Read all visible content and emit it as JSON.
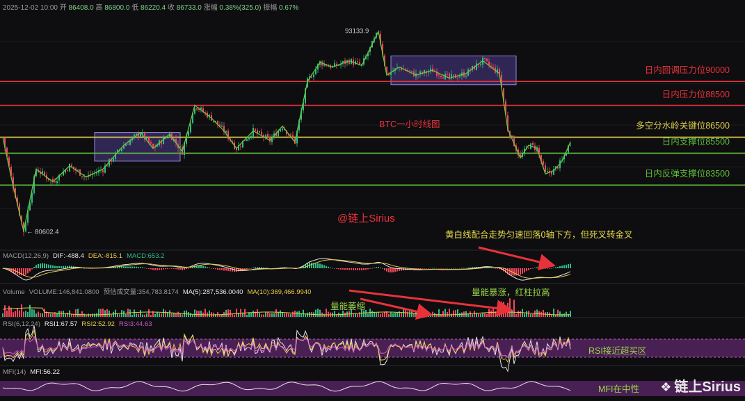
{
  "header": {
    "datetime": "2025-12-02 10:00",
    "open_label": "开",
    "open": "86408.0",
    "high_label": "高",
    "high": "86800.0",
    "low_label": "低",
    "low": "86220.4",
    "close_label": "收",
    "close": "86733.0",
    "change_label": "涨幅",
    "change": "0.38%(325.0)",
    "amp_label": "振幅",
    "amp": "0.67%"
  },
  "macd": {
    "title": "MACD(12,26,9)",
    "dif": "DIF:-488.4",
    "dea": "DEA:-815.1",
    "macd": "MACD:653.2"
  },
  "volume": {
    "title": "Volume",
    "vol": "VOLUME:146,841.0800",
    "est": "预估成交量:354,783.8174",
    "ma5": "MA(5):287,536.0040",
    "ma10": "MA(10):369,466.9940"
  },
  "rsi": {
    "title": "RSI(6,12,24)",
    "r1": "RSI1:67.57",
    "r2": "RSI2:52.92",
    "r3": "RSI3:44.63"
  },
  "mfi": {
    "title": "MFI(14)",
    "v": "MFI:56.22"
  },
  "levels": [
    {
      "label": "日内回调压力位90000",
      "price": 90000,
      "color": "#e8323a"
    },
    {
      "label": "日内压力位88500",
      "price": 88500,
      "color": "#e8323a"
    },
    {
      "label": "多空分水岭关键位86500",
      "price": 86500,
      "color": "#d9c84a"
    },
    {
      "label": "日内支撑位85500",
      "price": 85500,
      "color": "#5fbf3a"
    },
    {
      "label": "日内反弹支撑位83500",
      "price": 83500,
      "color": "#5fbf3a"
    }
  ],
  "annotations": {
    "chart_title": "BTC一小时线图",
    "author": "@链上Sirius",
    "macd_note": "黄白线配合走势匀速回落0轴下方，但死叉转金叉",
    "vol_spike": "量能暴涨，红柱拉高",
    "vol_shrink": "量能萎缩",
    "rsi_note": "RSI接近超买区",
    "mfi_note": "MFI在中性",
    "watermark": "链上Sirius"
  },
  "colors": {
    "up": "#2ebd85",
    "down": "#f6465d",
    "box": "#6a4fc4",
    "macd_dif": "#e6e6e6",
    "macd_dea": "#e6c84a",
    "rsi_band": "#7a2f8a"
  },
  "chart_data": {
    "type": "candlestick",
    "title": "BTC一小时线图",
    "ylim": [
      79500,
      94500
    ],
    "high_marker": {
      "label": "93133.9",
      "value": 93133.9
    },
    "low_marker": {
      "label": "80602.4",
      "value": 80602.4
    },
    "path": [
      [
        0,
        86500
      ],
      [
        4,
        84000
      ],
      [
        10,
        80602.4
      ],
      [
        16,
        84500
      ],
      [
        24,
        83700
      ],
      [
        32,
        84700
      ],
      [
        40,
        84000
      ],
      [
        48,
        84500
      ],
      [
        58,
        86000
      ],
      [
        66,
        86800
      ],
      [
        72,
        85800
      ],
      [
        80,
        86700
      ],
      [
        86,
        85600
      ],
      [
        92,
        88500
      ],
      [
        100,
        87700
      ],
      [
        106,
        86900
      ],
      [
        112,
        85800
      ],
      [
        120,
        86900
      ],
      [
        128,
        86300
      ],
      [
        134,
        87200
      ],
      [
        140,
        86200
      ],
      [
        146,
        90000
      ],
      [
        152,
        91200
      ],
      [
        158,
        90900
      ],
      [
        166,
        91300
      ],
      [
        172,
        91000
      ],
      [
        180,
        93133.9
      ],
      [
        184,
        90400
      ],
      [
        190,
        90900
      ],
      [
        198,
        90400
      ],
      [
        206,
        90700
      ],
      [
        214,
        90200
      ],
      [
        222,
        90500
      ],
      [
        230,
        91300
      ],
      [
        238,
        90500
      ],
      [
        242,
        87000
      ],
      [
        248,
        85200
      ],
      [
        252,
        86000
      ],
      [
        256,
        85800
      ],
      [
        260,
        84200
      ],
      [
        264,
        84400
      ],
      [
        268,
        85000
      ],
      [
        272,
        86200
      ]
    ],
    "boxes": [
      {
        "from": 44,
        "to": 85,
        "high": 86800,
        "low": 85000
      },
      {
        "from": 186,
        "to": 246,
        "high": 91600,
        "low": 89800
      }
    ]
  }
}
